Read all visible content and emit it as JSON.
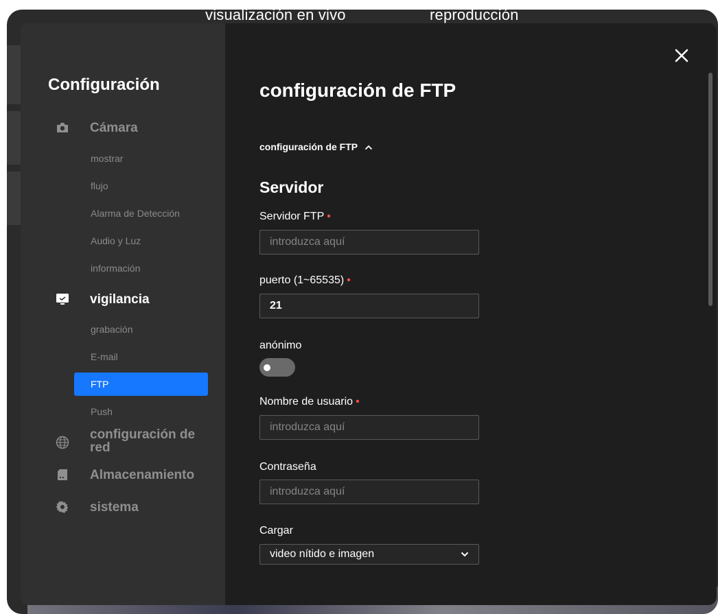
{
  "top_tabs": {
    "live": "visualización en vivo",
    "playback": "reproducción"
  },
  "sidebar": {
    "title": "Configuración",
    "sections": [
      {
        "label": "Cámara",
        "icon": "camera-icon",
        "items": [
          "mostrar",
          "flujo",
          "Alarma de Detección",
          "Audio y Luz",
          "información"
        ]
      },
      {
        "label": "vigilancia",
        "icon": "monitor-icon",
        "items": [
          "grabación",
          "E-mail",
          "FTP",
          "Push"
        ]
      },
      {
        "label": "configuración de red",
        "label_line1": "configuración de",
        "label_line2": "red",
        "icon": "globe-icon"
      },
      {
        "label": "Almacenamiento",
        "icon": "sd-card-icon"
      },
      {
        "label": "sistema",
        "icon": "gear-icon"
      }
    ],
    "active_item": "FTP"
  },
  "content": {
    "title": "configuración de FTP",
    "collapse_label": "configuración de FTP",
    "section_title": "Servidor",
    "fields": {
      "server": {
        "label": "Servidor FTP",
        "placeholder": "introduzca aquí",
        "value": ""
      },
      "port": {
        "label": "puerto (1~65535)",
        "value": "21"
      },
      "anonymous": {
        "label": "anónimo",
        "enabled": false
      },
      "username": {
        "label": "Nombre de usuario",
        "placeholder": "introduzca aquí",
        "value": ""
      },
      "password": {
        "label": "Contraseña",
        "placeholder": "introduzca aquí",
        "value": ""
      },
      "upload": {
        "label": "Cargar",
        "selected": "video nítido e imagen"
      }
    }
  },
  "colors": {
    "accent": "#1677ff",
    "required": "#ff4d4f",
    "modal_bg": "#1e1e1e",
    "sidebar_bg": "#303030"
  }
}
